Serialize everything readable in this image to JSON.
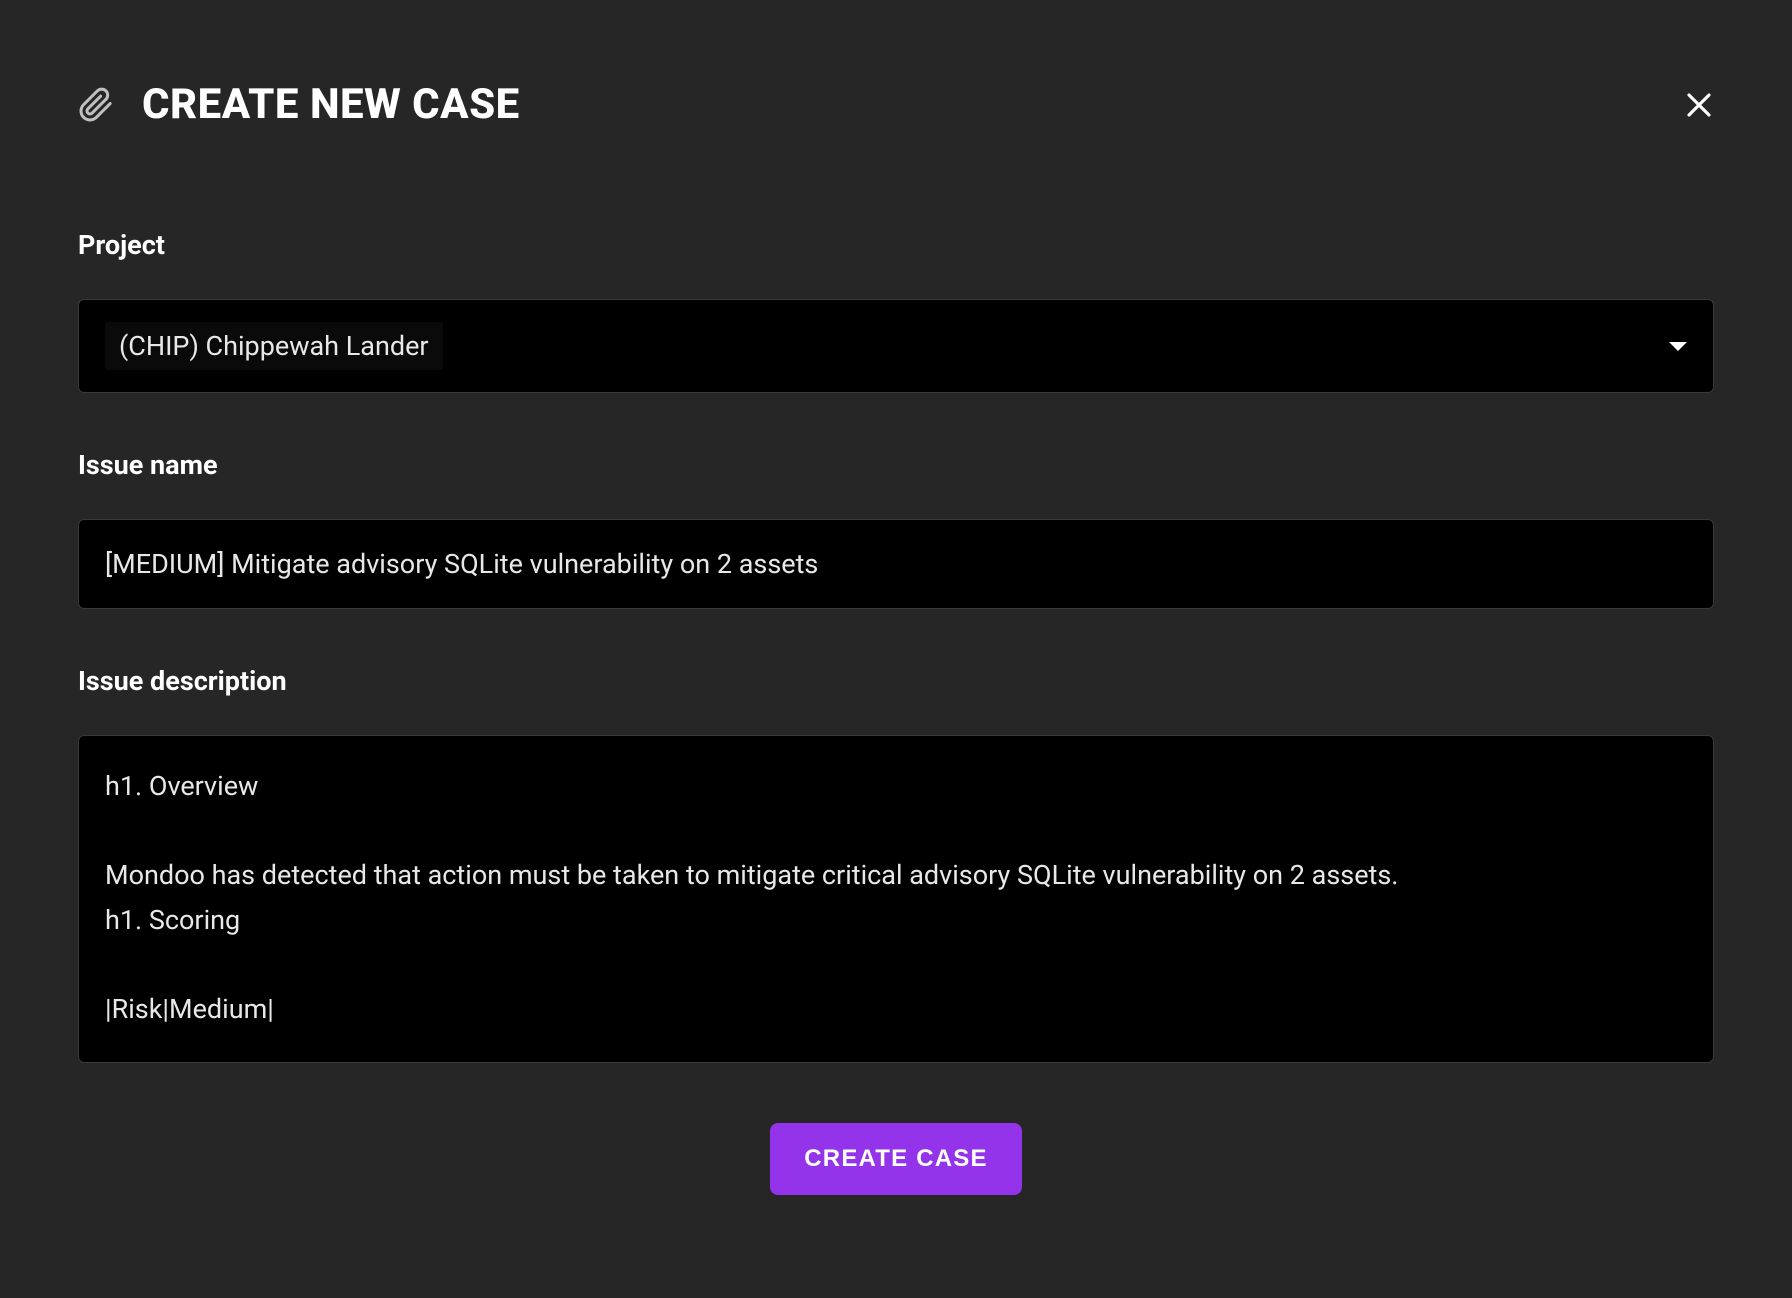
{
  "header": {
    "title": "CREATE NEW CASE"
  },
  "form": {
    "project": {
      "label": "Project",
      "selected": "(CHIP) Chippewah Lander"
    },
    "issue_name": {
      "label": "Issue name",
      "value": "[MEDIUM] Mitigate advisory SQLite vulnerability on 2 assets"
    },
    "issue_description": {
      "label": "Issue description",
      "value": "h1. Overview\n\nMondoo has detected that action must be taken to mitigate critical advisory SQLite vulnerability on 2 assets.\nh1. Scoring\n\n|Risk|Medium|"
    },
    "submit_label": "CREATE CASE"
  }
}
